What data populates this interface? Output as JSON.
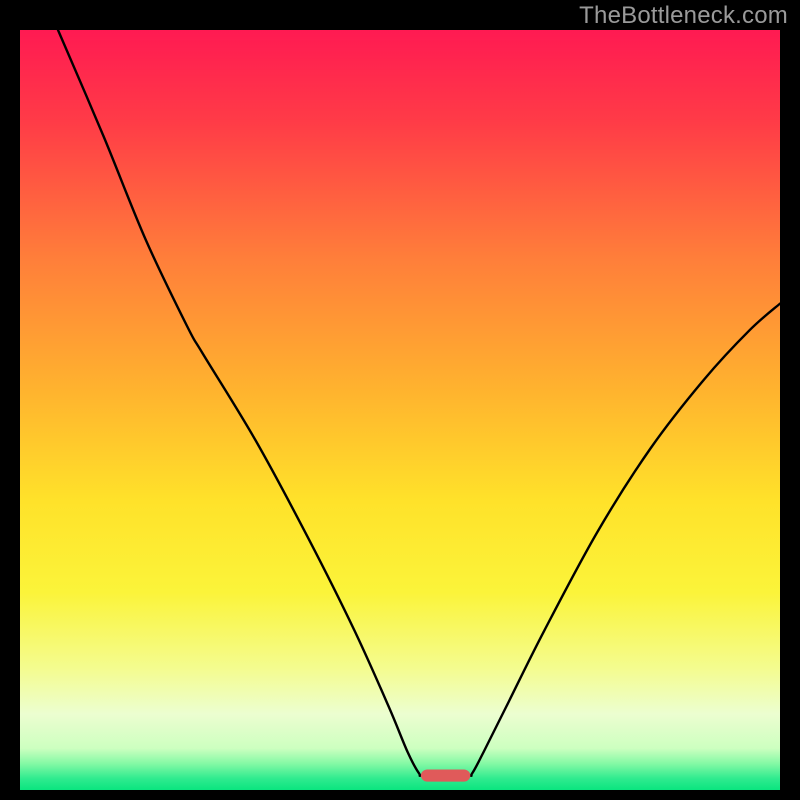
{
  "watermark": {
    "text": "TheBottleneck.com"
  },
  "chart_data": {
    "type": "line",
    "title": "",
    "xlabel": "",
    "ylabel": "",
    "xlim": [
      0,
      100
    ],
    "ylim": [
      0,
      100
    ],
    "grid": false,
    "legend": false,
    "background_gradient_stops": [
      {
        "offset": 0.0,
        "color": "#ff1a52"
      },
      {
        "offset": 0.12,
        "color": "#ff3b47"
      },
      {
        "offset": 0.3,
        "color": "#ff7e3a"
      },
      {
        "offset": 0.48,
        "color": "#ffb52e"
      },
      {
        "offset": 0.62,
        "color": "#ffe22a"
      },
      {
        "offset": 0.74,
        "color": "#fbf43a"
      },
      {
        "offset": 0.84,
        "color": "#f4fc8f"
      },
      {
        "offset": 0.9,
        "color": "#ecfed0"
      },
      {
        "offset": 0.945,
        "color": "#cdffc0"
      },
      {
        "offset": 0.965,
        "color": "#85f9a5"
      },
      {
        "offset": 0.985,
        "color": "#2feb8f"
      },
      {
        "offset": 1.0,
        "color": "#0ae57f"
      }
    ],
    "series": [
      {
        "name": "curve",
        "color": "#000000",
        "points": [
          {
            "x": 5.0,
            "y": 100.0
          },
          {
            "x": 11.0,
            "y": 86.0
          },
          {
            "x": 16.5,
            "y": 72.5
          },
          {
            "x": 22.0,
            "y": 61.0
          },
          {
            "x": 24.0,
            "y": 57.5
          },
          {
            "x": 31.0,
            "y": 46.0
          },
          {
            "x": 38.0,
            "y": 33.0
          },
          {
            "x": 44.0,
            "y": 21.0
          },
          {
            "x": 48.5,
            "y": 11.0
          },
          {
            "x": 51.0,
            "y": 5.0
          },
          {
            "x": 52.5,
            "y": 2.2
          },
          {
            "x": 53.2,
            "y": 1.9
          },
          {
            "x": 58.8,
            "y": 1.9
          },
          {
            "x": 59.5,
            "y": 2.2
          },
          {
            "x": 61.0,
            "y": 5.0
          },
          {
            "x": 64.0,
            "y": 11.0
          },
          {
            "x": 69.0,
            "y": 21.0
          },
          {
            "x": 76.0,
            "y": 34.0
          },
          {
            "x": 83.0,
            "y": 45.0
          },
          {
            "x": 90.0,
            "y": 54.0
          },
          {
            "x": 96.0,
            "y": 60.5
          },
          {
            "x": 100.0,
            "y": 64.0
          }
        ]
      }
    ],
    "marker": {
      "name": "min-marker",
      "x_center": 56.0,
      "y_center": 1.9,
      "width": 6.5,
      "height": 1.6,
      "color": "#e05a5a",
      "rx": 0.85
    }
  }
}
